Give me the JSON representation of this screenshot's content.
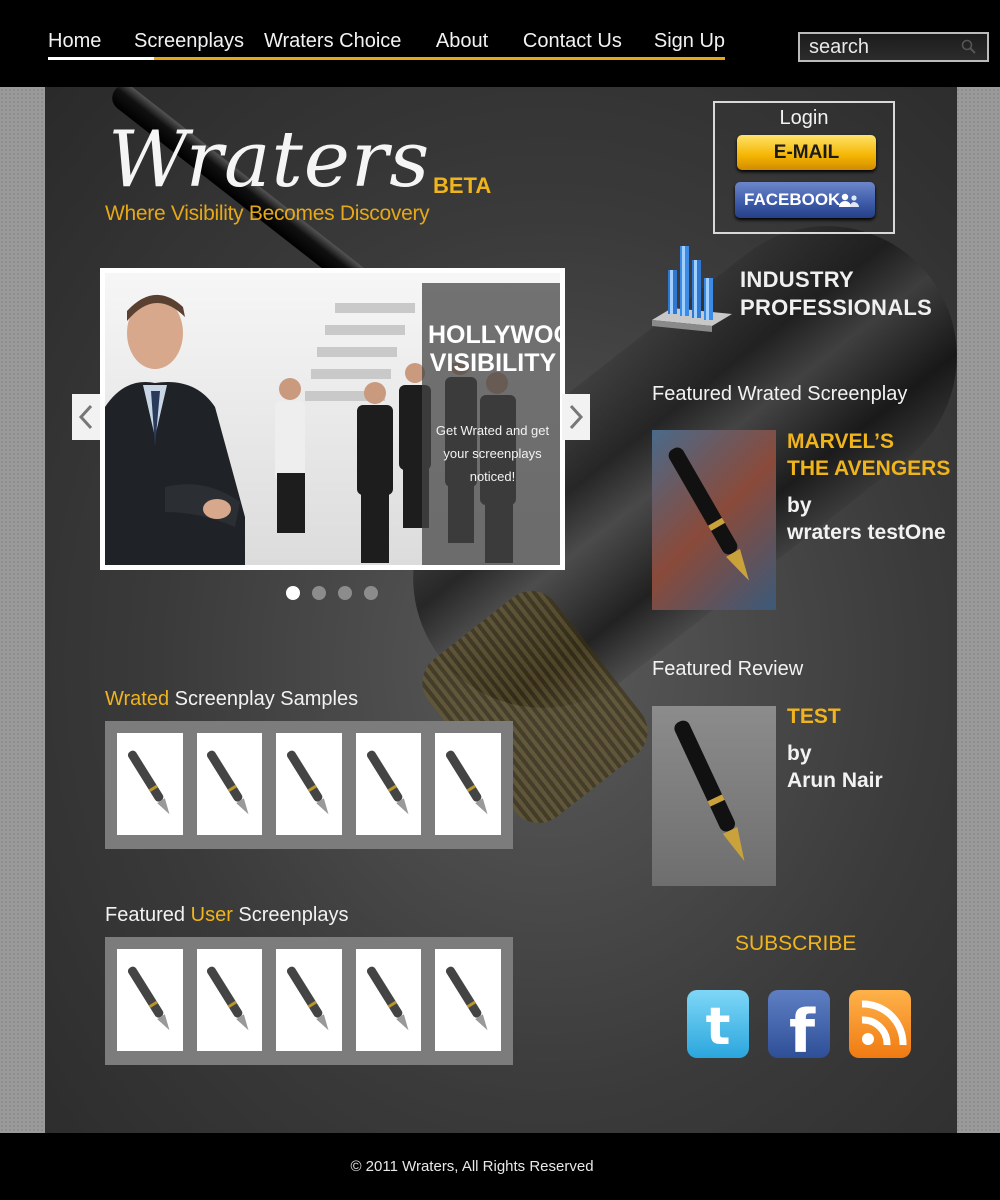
{
  "nav": {
    "items": [
      {
        "label": "Home"
      },
      {
        "label": "Screenplays"
      },
      {
        "label": "Wraters Choice"
      },
      {
        "label": "About"
      },
      {
        "label": "Contact Us"
      },
      {
        "label": "Sign Up"
      }
    ],
    "active": "Home"
  },
  "search": {
    "placeholder": "search",
    "icon": "search-icon"
  },
  "logo": {
    "name": "Wraters",
    "beta": "BETA",
    "tagline": "Where Visibility Becomes Discovery"
  },
  "login": {
    "title": "Login",
    "email_label": "E-MAIL",
    "facebook_label": "FACEBOOK"
  },
  "industry": {
    "line1": "INDUSTRY",
    "line2": "PROFESSIONALS"
  },
  "slider": {
    "heading_line1": "HOLLYWOOD",
    "heading_line2": "VISIBILITY",
    "text": "Get Wrated and get your screenplays noticed!",
    "dots": 4,
    "active_dot": 1
  },
  "samples": {
    "highlight": "Wrated",
    "rest": "Screenplay Samples",
    "count": 5
  },
  "user_screenplays": {
    "prefix": "Featured",
    "highlight": "User",
    "suffix": "Screenplays",
    "count": 5
  },
  "featured_screenplay": {
    "label": "Featured Wrated Screenplay",
    "title_line1": "MARVEL’S",
    "title_line2": "THE AVENGERS",
    "by": "by",
    "author": "wraters testOne"
  },
  "featured_review": {
    "label": "Featured Review",
    "title": "TEST",
    "by": "by",
    "author": "Arun Nair"
  },
  "subscribe": {
    "label": "SUBSCRIBE",
    "icons": [
      "twitter-icon",
      "facebook-icon",
      "rss-icon"
    ]
  },
  "footer": {
    "text": "© 2011 Wraters, All Rights Reserved"
  },
  "colors": {
    "accent": "#f0b41c",
    "nav_underline": "#e6a817",
    "background": "#000000"
  }
}
